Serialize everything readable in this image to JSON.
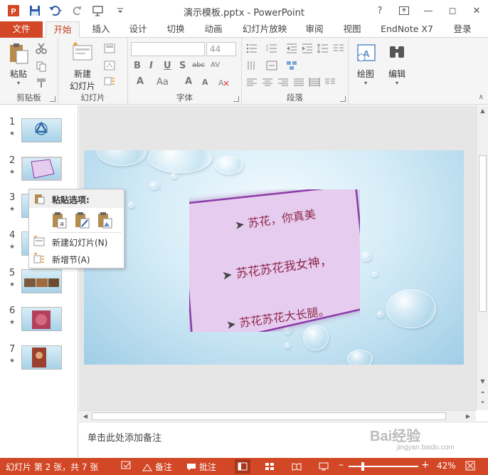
{
  "window": {
    "title": "演示模板.pptx - PowerPoint",
    "controls": [
      "?",
      "⬜",
      "—",
      "◻",
      "✕"
    ]
  },
  "tabs": [
    {
      "label": "文件"
    },
    {
      "label": "开始"
    },
    {
      "label": "插入"
    },
    {
      "label": "设计"
    },
    {
      "label": "切换"
    },
    {
      "label": "动画"
    },
    {
      "label": "幻灯片放映"
    },
    {
      "label": "审阅"
    },
    {
      "label": "视图"
    },
    {
      "label": "EndNote X7"
    },
    {
      "label": "登录"
    }
  ],
  "ribbon": {
    "clipboard": {
      "paste_label": "粘贴",
      "group_label": "剪贴板"
    },
    "slides": {
      "new_slide_label": "新建\n幻灯片",
      "new_slide_line1": "新建",
      "new_slide_line2": "幻灯片",
      "group_label": "幻灯片"
    },
    "font": {
      "size_value": "44",
      "group_label": "字体"
    },
    "paragraph": {
      "group_label": "段落"
    },
    "drawing": {
      "label": "绘图"
    },
    "editing": {
      "label": "编辑"
    }
  },
  "thumbnails": [
    {
      "num": "1",
      "star": "★"
    },
    {
      "num": "2",
      "star": "★"
    },
    {
      "num": "3",
      "star": "★"
    },
    {
      "num": "4",
      "star": "★"
    },
    {
      "num": "5",
      "star": "★"
    },
    {
      "num": "6",
      "star": "★"
    },
    {
      "num": "7",
      "star": "★"
    }
  ],
  "slide": {
    "lines": [
      "苏花，你真美",
      "苏花苏花我女神，",
      "苏花苏花大长腿。"
    ]
  },
  "context_menu": {
    "header": "粘贴选项:",
    "items": [
      "新建幻灯片(N)",
      "新增节(A)"
    ]
  },
  "notes": {
    "placeholder": "单击此处添加备注"
  },
  "statusbar": {
    "slide_info": "幻灯片 第 2 张，共 7 张",
    "notes_label": "备注",
    "comments_label": "批注",
    "zoom": "42%"
  },
  "watermark": {
    "text": "Bai经验",
    "sub": "jingyan.baidu.com"
  },
  "colors": {
    "accent": "#d24726",
    "slide_card": "#e6ccef",
    "card_border": "#8a3aa6"
  }
}
